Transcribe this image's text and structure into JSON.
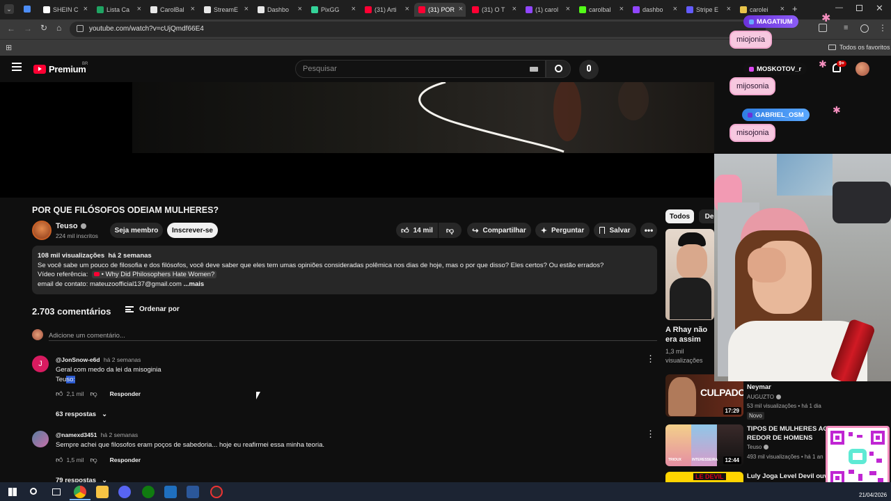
{
  "browser": {
    "tabs": [
      {
        "label": "SHEIN C",
        "color": "#ffffff"
      },
      {
        "label": "Lista Ca",
        "color": "#1fa463"
      },
      {
        "label": "CarolBal",
        "color": "#e8e8e8"
      },
      {
        "label": "StreamE",
        "color": "#e8e8e8"
      },
      {
        "label": "Dashbo",
        "color": "#e8e8e8"
      },
      {
        "label": "PixGG",
        "color": "#34d399"
      },
      {
        "label": "(31) Arti",
        "color": "#ff0033"
      },
      {
        "label": "(31) POR",
        "color": "#ff0033"
      },
      {
        "label": "(31) O T",
        "color": "#ff0033"
      },
      {
        "label": "(1) carol",
        "color": "#9146ff"
      },
      {
        "label": "carolbal",
        "color": "#53fc18"
      },
      {
        "label": "dashbo",
        "color": "#9146ff"
      },
      {
        "label": "Stripe E",
        "color": "#635bff"
      },
      {
        "label": "carolei",
        "color": "#e8c44a"
      }
    ],
    "url": "youtube.com/watch?v=cUjQmdf66E4",
    "bookmarks_folder": "Todos os favoritos"
  },
  "youtube": {
    "logo_text": "Premium",
    "logo_region": "BR",
    "search_placeholder": "Pesquisar",
    "notifications_badge": "9+"
  },
  "video": {
    "title": "POR QUE FILÓSOFOS ODEIAM MULHERES?",
    "channel_name": "Teuso",
    "subscribers": "224 mil inscritos",
    "join_label": "Seja membro",
    "subscribe_label": "Inscrever-se",
    "likes": "14 mil",
    "share_label": "Compartilhar",
    "ask_label": "Perguntar",
    "save_label": "Salvar"
  },
  "description": {
    "stats": "108 mil visualizações  há 2 semanas",
    "line1": "Se você sabe um pouco de filosofia e dos filósofos, você deve saber que eles tem umas opiniões consideradas polêmica nos dias de hoje, mas o por que disso? Eles certos? Ou estão errados?",
    "ref_prefix": "Vídeo referência:",
    "ref_link": "• Why Did Philosophers Hate Women?",
    "contact": "email de contato: mateuzoofficial137@gmail.com",
    "more": "...mais"
  },
  "comments": {
    "count": "2.703 comentários",
    "sort_label": "Ordenar por",
    "add_placeholder": "Adicione um comentário...",
    "items": [
      {
        "avatar_letter": "J",
        "author": "@JonSnow-e6d",
        "time": "há 2 semanas",
        "text1": "Geral com medo da lei da misoginia",
        "text2_a": "Teu",
        "text2_b": "so:",
        "likes": "2,1 mil",
        "reply": "Responder",
        "replies": "63 respostas"
      },
      {
        "author": "@namexd3451",
        "time": "há 2 semanas",
        "text1": "Sempre achei que filosofos eram poços de sabedoria...  hoje eu reafirmei essa minha teoria.",
        "likes": "1,5 mil",
        "reply": "Responder",
        "replies": "79 respostas"
      }
    ]
  },
  "sidebar": {
    "chips": [
      "Todos",
      "De"
    ],
    "items": [
      {
        "title1": "A Rhay não",
        "title2": "era assim",
        "meta1": "1,3 mil",
        "meta2": "visualizações"
      },
      {
        "title1": "Neymar",
        "channel": "AUGUZTO",
        "meta": "53 mil visualizações • há 1 dia",
        "badge": "Novo",
        "thumb_text": "CULPADO",
        "duration": "17:29"
      },
      {
        "title1": "TIPOS DE MULHERES AO",
        "title2": "REDOR DE HOMENS",
        "channel": "Teuso",
        "meta": "493 mil visualizações • há 1 an",
        "duration": "12:44",
        "thumb_labels": [
          "TRIOUX",
          "INTERESSEIRA",
          "..."
        ]
      },
      {
        "title1": "Luly Joga Level Devil ouvin",
        "thumb_text": "LE DEVIL"
      }
    ]
  },
  "overlay": {
    "chat": [
      {
        "name": "MAGATIUM",
        "message": "miojonia"
      },
      {
        "name": "MOSKOTOV_r",
        "message": "mijosonia"
      },
      {
        "name": "GABRIEL_OSM",
        "message": "misojonia"
      }
    ]
  },
  "taskbar": {
    "date": "21/04/2026"
  }
}
